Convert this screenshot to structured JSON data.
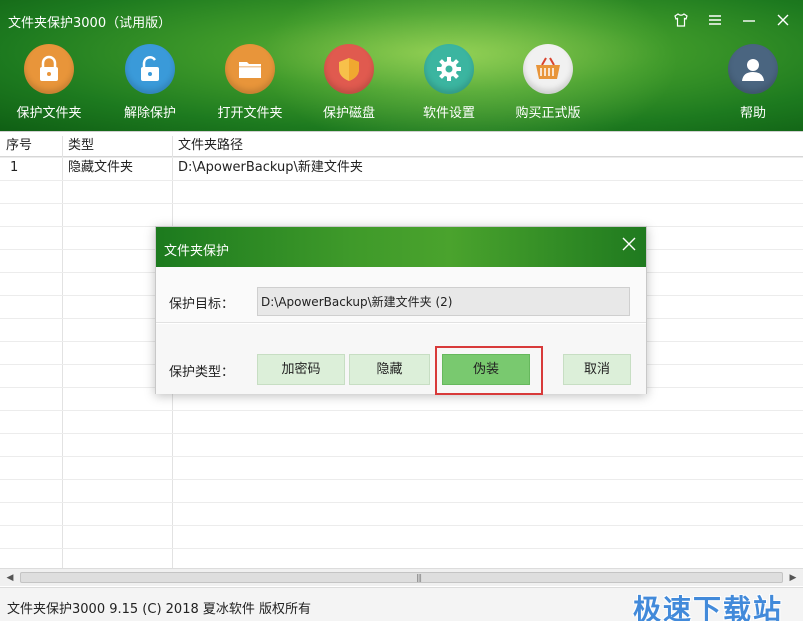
{
  "app": {
    "title": "文件夹保护3000（试用版）",
    "window_controls": [
      "shirt-icon",
      "menu-icon",
      "minimize-icon",
      "close-icon"
    ]
  },
  "toolbar": {
    "items": [
      {
        "label": "保护文件夹",
        "icon": "lock-closed-icon",
        "color": "#e8953a"
      },
      {
        "label": "解除保护",
        "icon": "lock-open-icon",
        "color": "#3a9ad9"
      },
      {
        "label": "打开文件夹",
        "icon": "folder-icon",
        "color": "#e8953a"
      },
      {
        "label": "保护磁盘",
        "icon": "shield-icon",
        "color": "#e05a4f"
      },
      {
        "label": "软件设置",
        "icon": "gear-icon",
        "color": "#3bb5a0"
      },
      {
        "label": "购买正式版",
        "icon": "basket-icon",
        "color": "#e8953a"
      },
      {
        "label": "帮助",
        "icon": "user-icon",
        "color": "#4a6580"
      }
    ]
  },
  "table": {
    "columns": [
      "序号",
      "类型",
      "文件夹路径"
    ],
    "rows": [
      {
        "index": "1",
        "type": "隐藏文件夹",
        "path": "D:\\ApowerBackup\\新建文件夹"
      }
    ]
  },
  "dialog": {
    "title": "文件夹保护",
    "target_label": "保护目标：",
    "target_value": "D:\\ApowerBackup\\新建文件夹 (2)",
    "type_label": "保护类型：",
    "buttons": {
      "encrypt": "加密码",
      "hide": "隐藏",
      "disguise": "伪装",
      "cancel": "取消"
    },
    "active_button": "disguise"
  },
  "statusbar": {
    "text": "文件夹保护3000 9.15 (C) 2018 夏冰软件 版权所有",
    "watermark": "极速下载站"
  }
}
